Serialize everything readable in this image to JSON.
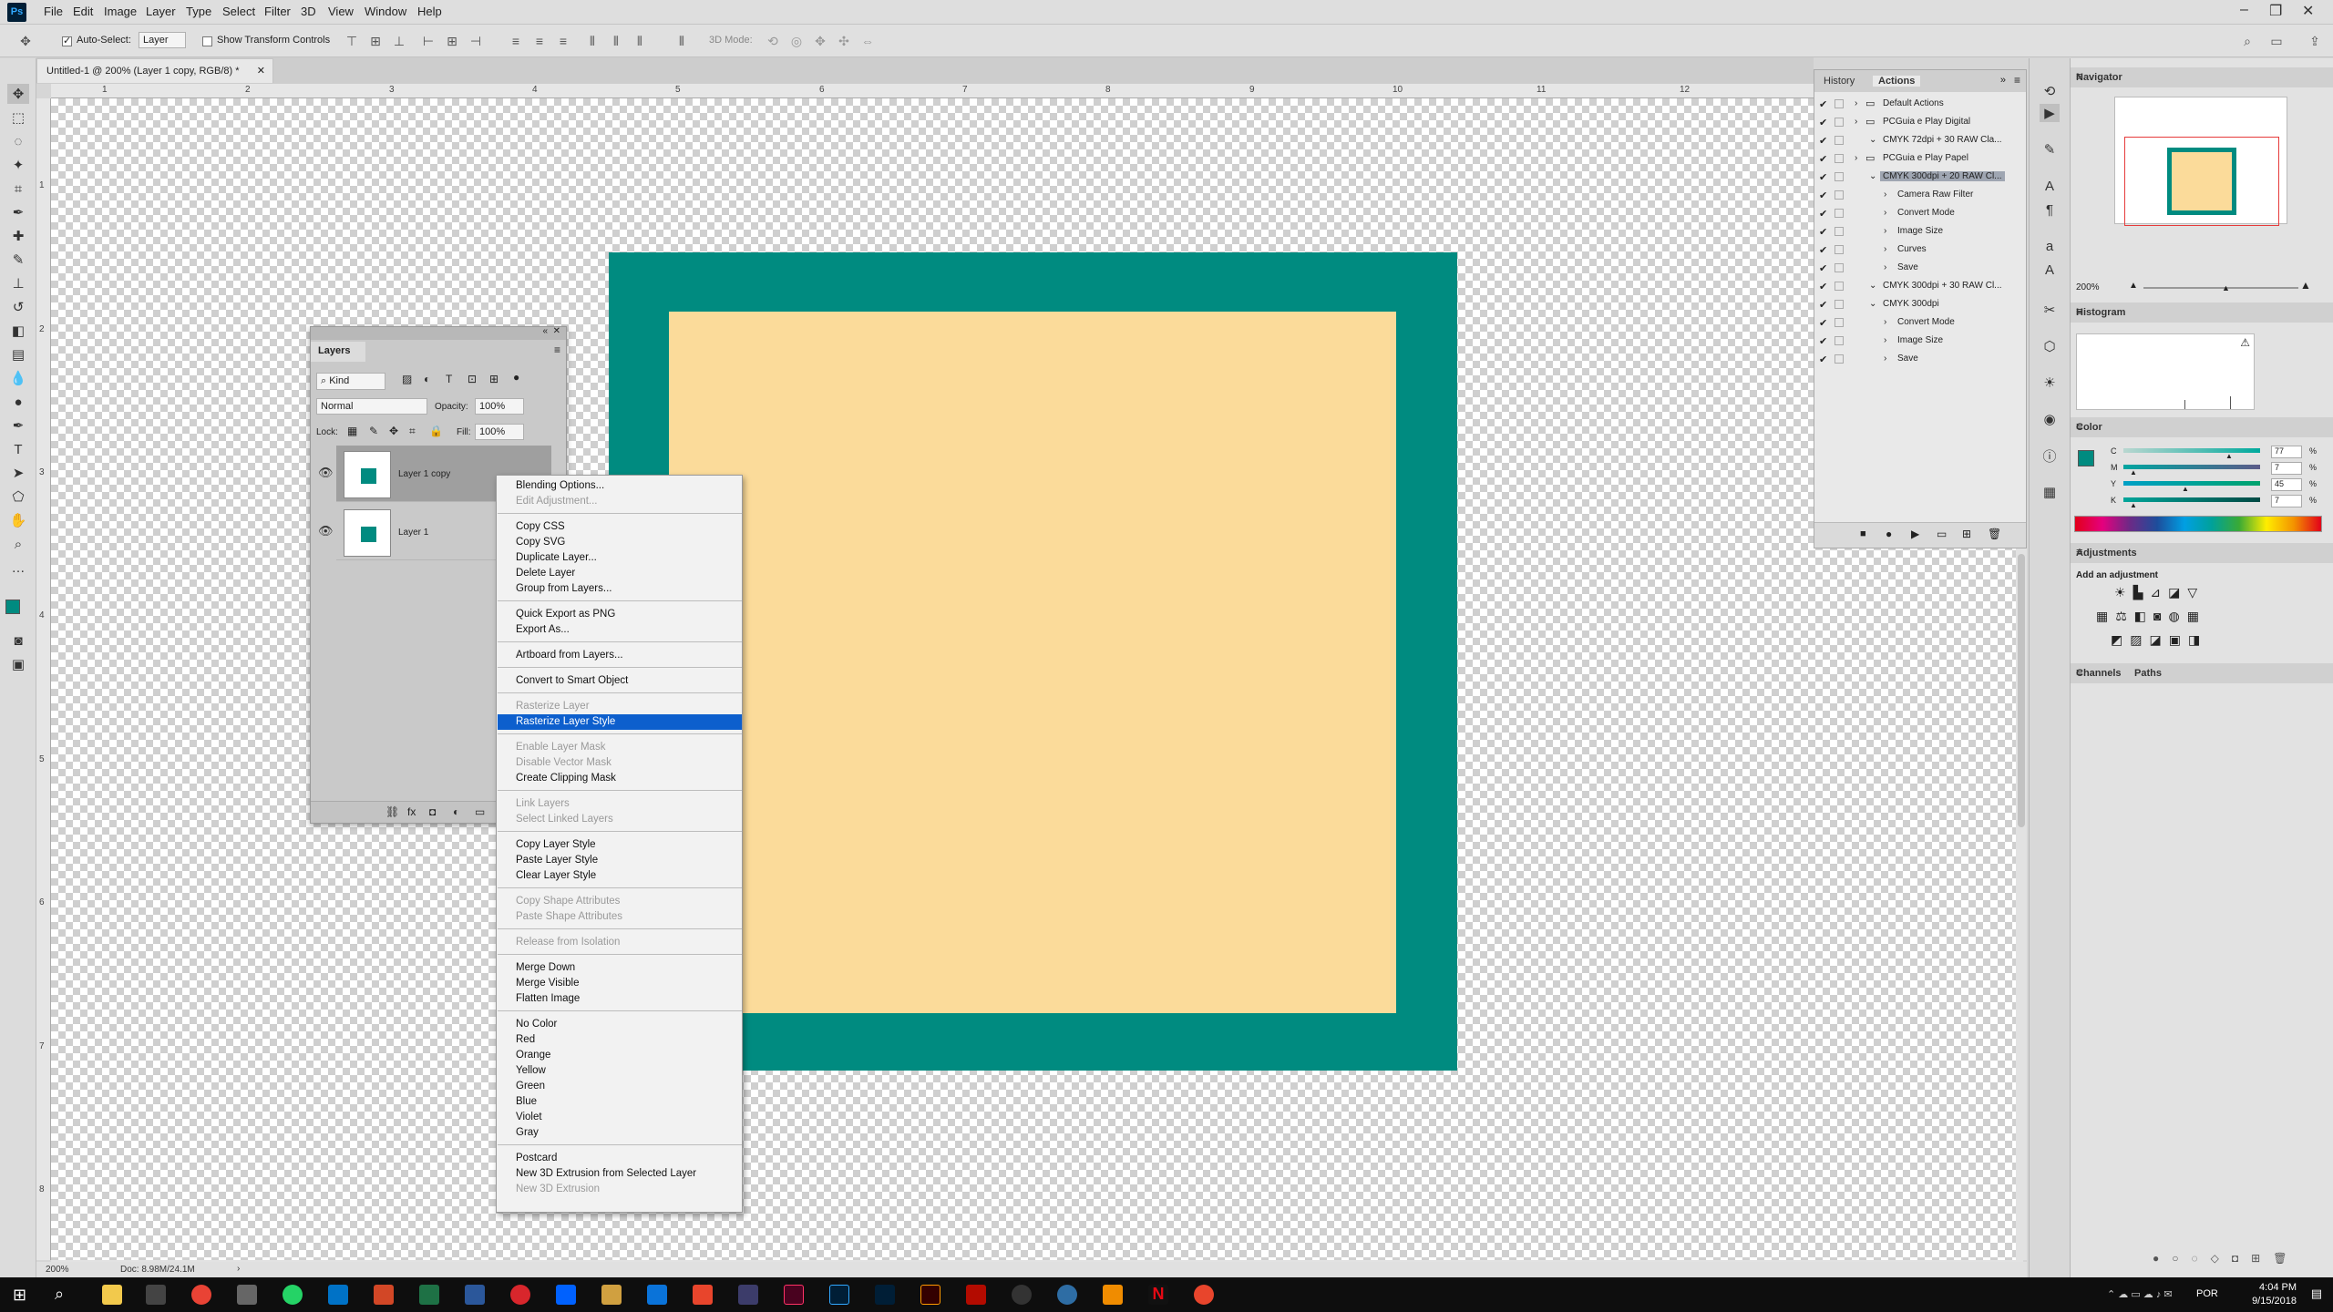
{
  "app": {
    "logo": "Ps",
    "menus": [
      "File",
      "Edit",
      "Image",
      "Layer",
      "Type",
      "Select",
      "Filter",
      "3D",
      "View",
      "Window",
      "Help"
    ]
  },
  "options_bar": {
    "auto_select_label": "Auto-Select:",
    "auto_select_value": "Layer",
    "show_transform_label": "Show Transform Controls",
    "mode3d_label": "3D Mode:"
  },
  "document": {
    "tab_title": "Untitled-1 @ 200% (Layer 1 copy, RGB/8) *",
    "zoom": "200%",
    "doc_info": "Doc: 8.98M/24.1M",
    "ruler_numbers": [
      "1",
      "2",
      "3",
      "4",
      "5",
      "6",
      "7",
      "8",
      "9",
      "10",
      "11",
      "12"
    ],
    "ruler_v_numbers": [
      "1",
      "2",
      "3",
      "4",
      "5",
      "6",
      "7",
      "8"
    ],
    "colors": {
      "frame": "#008b80",
      "inner": "#fbdb9a"
    }
  },
  "layers_panel": {
    "title": "Layers",
    "kind_label": "Kind",
    "blend_mode": "Normal",
    "opacity_label": "Opacity:",
    "opacity_value": "100%",
    "lock_label": "Lock:",
    "fill_label": "Fill:",
    "fill_value": "100%",
    "layers": [
      {
        "name": "Layer 1 copy",
        "selected": true
      },
      {
        "name": "Layer 1",
        "selected": false
      }
    ]
  },
  "context_menu": {
    "items": [
      {
        "label": "Blending Options...",
        "disabled": false
      },
      {
        "label": "Edit Adjustment...",
        "disabled": true
      },
      {
        "label": "Copy CSS",
        "disabled": false
      },
      {
        "label": "Copy SVG",
        "disabled": false
      },
      {
        "label": "Duplicate Layer...",
        "disabled": false
      },
      {
        "label": "Delete Layer",
        "disabled": false
      },
      {
        "label": "Group from Layers...",
        "disabled": false
      },
      {
        "label": "Quick Export as PNG",
        "disabled": false
      },
      {
        "label": "Export As...",
        "disabled": false
      },
      {
        "label": "Artboard from Layers...",
        "disabled": false
      },
      {
        "label": "Convert to Smart Object",
        "disabled": false
      },
      {
        "label": "Rasterize Layer",
        "disabled": true
      },
      {
        "label": "Rasterize Layer Style",
        "disabled": false,
        "highlighted": true
      },
      {
        "label": "Enable Layer Mask",
        "disabled": true
      },
      {
        "label": "Disable Vector Mask",
        "disabled": true
      },
      {
        "label": "Create Clipping Mask",
        "disabled": false
      },
      {
        "label": "Link Layers",
        "disabled": true
      },
      {
        "label": "Select Linked Layers",
        "disabled": true
      },
      {
        "label": "Copy Layer Style",
        "disabled": false
      },
      {
        "label": "Paste Layer Style",
        "disabled": false
      },
      {
        "label": "Clear Layer Style",
        "disabled": false
      },
      {
        "label": "Copy Shape Attributes",
        "disabled": true
      },
      {
        "label": "Paste Shape Attributes",
        "disabled": true
      },
      {
        "label": "Release from Isolation",
        "disabled": true
      },
      {
        "label": "Merge Down",
        "disabled": false
      },
      {
        "label": "Merge Visible",
        "disabled": false
      },
      {
        "label": "Flatten Image",
        "disabled": false
      },
      {
        "label": "No Color",
        "disabled": false
      },
      {
        "label": "Red",
        "disabled": false
      },
      {
        "label": "Orange",
        "disabled": false
      },
      {
        "label": "Yellow",
        "disabled": false
      },
      {
        "label": "Green",
        "disabled": false
      },
      {
        "label": "Blue",
        "disabled": false
      },
      {
        "label": "Violet",
        "disabled": false
      },
      {
        "label": "Gray",
        "disabled": false
      },
      {
        "label": "Postcard",
        "disabled": false
      },
      {
        "label": "New 3D Extrusion from Selected Layer",
        "disabled": false
      },
      {
        "label": "New 3D Extrusion",
        "disabled": true
      }
    ]
  },
  "actions_panel": {
    "tabs": [
      "History",
      "Actions"
    ],
    "rows": [
      {
        "label": "Default Actions",
        "indent": 0,
        "folder": true
      },
      {
        "label": "PCGuia e Play  Digital",
        "indent": 0,
        "folder": true
      },
      {
        "label": "CMYK 72dpi + 30 RAW Cla...",
        "indent": 1
      },
      {
        "label": "PCGuia e Play  Papel",
        "indent": 0,
        "folder": true
      },
      {
        "label": "CMYK 300dpi + 20 RAW Cl...",
        "indent": 1,
        "selected": true
      },
      {
        "label": "Camera Raw Filter",
        "indent": 2
      },
      {
        "label": "Convert Mode",
        "indent": 2
      },
      {
        "label": "Image Size",
        "indent": 2
      },
      {
        "label": "Curves",
        "indent": 2
      },
      {
        "label": "Save",
        "indent": 2
      },
      {
        "label": "CMYK 300dpi + 30 RAW Cl...",
        "indent": 1
      },
      {
        "label": "CMYK 300dpi",
        "indent": 1
      },
      {
        "label": "Convert Mode",
        "indent": 2
      },
      {
        "label": "Image Size",
        "indent": 2
      },
      {
        "label": "Save",
        "indent": 2
      }
    ]
  },
  "navigator": {
    "title": "Navigator",
    "zoom": "200%"
  },
  "histogram": {
    "title": "Histogram"
  },
  "color_panel": {
    "title": "Color",
    "channels": [
      {
        "label": "C",
        "value": "77",
        "pct": 0.77
      },
      {
        "label": "M",
        "value": "7",
        "pct": 0.07
      },
      {
        "label": "Y",
        "value": "45",
        "pct": 0.45
      },
      {
        "label": "K",
        "value": "7",
        "pct": 0.07
      }
    ],
    "unit": "%",
    "foreground": "#008b80"
  },
  "adjustments": {
    "title": "Adjustments",
    "subtitle": "Add an adjustment"
  },
  "channels_paths": {
    "tabs": [
      "Channels",
      "Paths"
    ]
  },
  "taskbar": {
    "time": "4:04 PM",
    "date": "9/15/2018",
    "lang": "POR"
  }
}
